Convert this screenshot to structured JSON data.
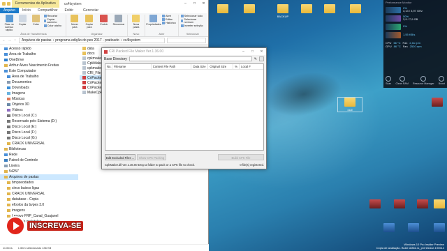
{
  "explorer": {
    "tools_tab": "Ferramentas de Aplicativo",
    "window_title": "cs4lsystem",
    "tabs": [
      "Arquivo",
      "Início",
      "Compartilhar",
      "Exibir"
    ],
    "manage_tab": "Gerenciar",
    "ribbon": {
      "clipboard": {
        "pin": "Fixar no Acesso rápido",
        "copy": "Copiar",
        "paste": "Colar",
        "cut": "Recortar",
        "copy_path": "Copiar caminho",
        "paste_shortcut": "Colar atalho",
        "group": "Área de Transferência"
      },
      "organize": {
        "move": "Mover para",
        "copy_to": "Copiar para",
        "delete": "Excluir",
        "rename": "Renomear",
        "group": "Organizar"
      },
      "new": {
        "new_folder": "Nova pasta",
        "group": "Novo"
      },
      "open": {
        "properties": "Propriedades",
        "open": "Abrir",
        "edit": "Editar",
        "history": "Histórico",
        "group": "Abrir"
      },
      "select": {
        "select_all": "Selecionar tudo",
        "select_none": "Selecionar nenhum",
        "invert": "Inverter seleção",
        "group": "Selecionar"
      }
    },
    "address_parts": [
      "Arquivos de pastas",
      "programa edição do pes 2017 - praticado",
      "cs4lsystem"
    ],
    "nav_tree": [
      "Acesso rápido",
      "Área de Trabalho",
      "OneDrive",
      "Arthur Alves Nascimento Freitas",
      "Este Computador",
      "Área de Trabalho",
      "Documentos",
      "Downloads",
      "Imagens",
      "Músicas",
      "Objetos 3D",
      "Vídeos",
      "Disco Local (C:)",
      "Reservado pelo Sistema (D:)",
      "Disco Local (E:)",
      "Disco Local (F:)",
      "Disco Local (G:)",
      "CRACK UNIVERSAL",
      "Bibliotecas",
      "Rede",
      "Painel de Controle",
      "Lixeira",
      "54257",
      "Arquivos de pastas",
      "bmpseodados",
      "cinco baixos ligas",
      "CRACK UNIVERSAL",
      "database - Copia",
      "efoolos da bvpes 3.0",
      "imagens",
      "Lenovo FRP_Canal_Guajanel",
      "menu de moletoles"
    ],
    "files": [
      "data",
      "docs",
      "cpkmaker.dll",
      "CpkMaker.dll.config",
      "cpkmaker.dll.xml",
      "CRI_File_System",
      "CriPackedFileMaker",
      "CriPackedFileMaker",
      "CriPackedFileMaker",
      "MakeCpk.a"
    ],
    "status_items": "11 itens",
    "status_selected": "1 item selecionado 136 KB"
  },
  "dialog": {
    "title": "CRI Packed File Maker Ver.1.36.00",
    "base_dir_label": "Base Directory",
    "columns": [
      "No.",
      "Filename",
      "Content File Path",
      "Data Size",
      "Original Size",
      "%",
      "Local F"
    ],
    "edit_excluded": "Edit Excluded Files ...",
    "show_cpk": "Show CPK Packing",
    "build_cpk": "Build CPK File",
    "status_msg": "CpkMaker.dll Ver.1.36.00   Drop a folder to pack or a CPK file to check.",
    "file_status": "0 file(s) registered."
  },
  "perf": {
    "header": "Performance Monitor",
    "cpu_pct": "0%",
    "cpu_speed": "3,13 / 3,97 GHz",
    "ram_pct": "50%",
    "ram_val": "3,9 / 7,9 GB",
    "disk_pct": "0%",
    "net_val": "1,55 KB/s",
    "cpu_temp_label": "CPU",
    "cpu_temp": "66 °C",
    "cpu_fan_label": "Fan",
    "cpu_fan": "2,1k rpm",
    "gpu_temp_label": "GPU",
    "gpu_temp": "86 °C",
    "gpu_fan_label": "Fan",
    "gpu_fan": "2520 rpm",
    "actions": [
      "Scan",
      "Clean RAM",
      "Resource Manager",
      "Boost"
    ]
  },
  "desktop_icons": [
    {
      "label": "",
      "kind": "folder"
    },
    {
      "label": "",
      "kind": "folder"
    },
    {
      "label": "BACKUP",
      "kind": "folder"
    },
    {
      "label": "",
      "kind": "folder"
    },
    {
      "label": "",
      "kind": "folder"
    },
    {
      "label": "",
      "kind": "folder"
    },
    {
      "label": "cs4l",
      "kind": "folder"
    },
    {
      "label": "",
      "kind": "img"
    }
  ],
  "watermark": "INSCREVA-SE",
  "win_watermark": "Windows 10 Pro Insider Preview\nCópia de avaliação. Build 18362.rs_prerelease.190614"
}
